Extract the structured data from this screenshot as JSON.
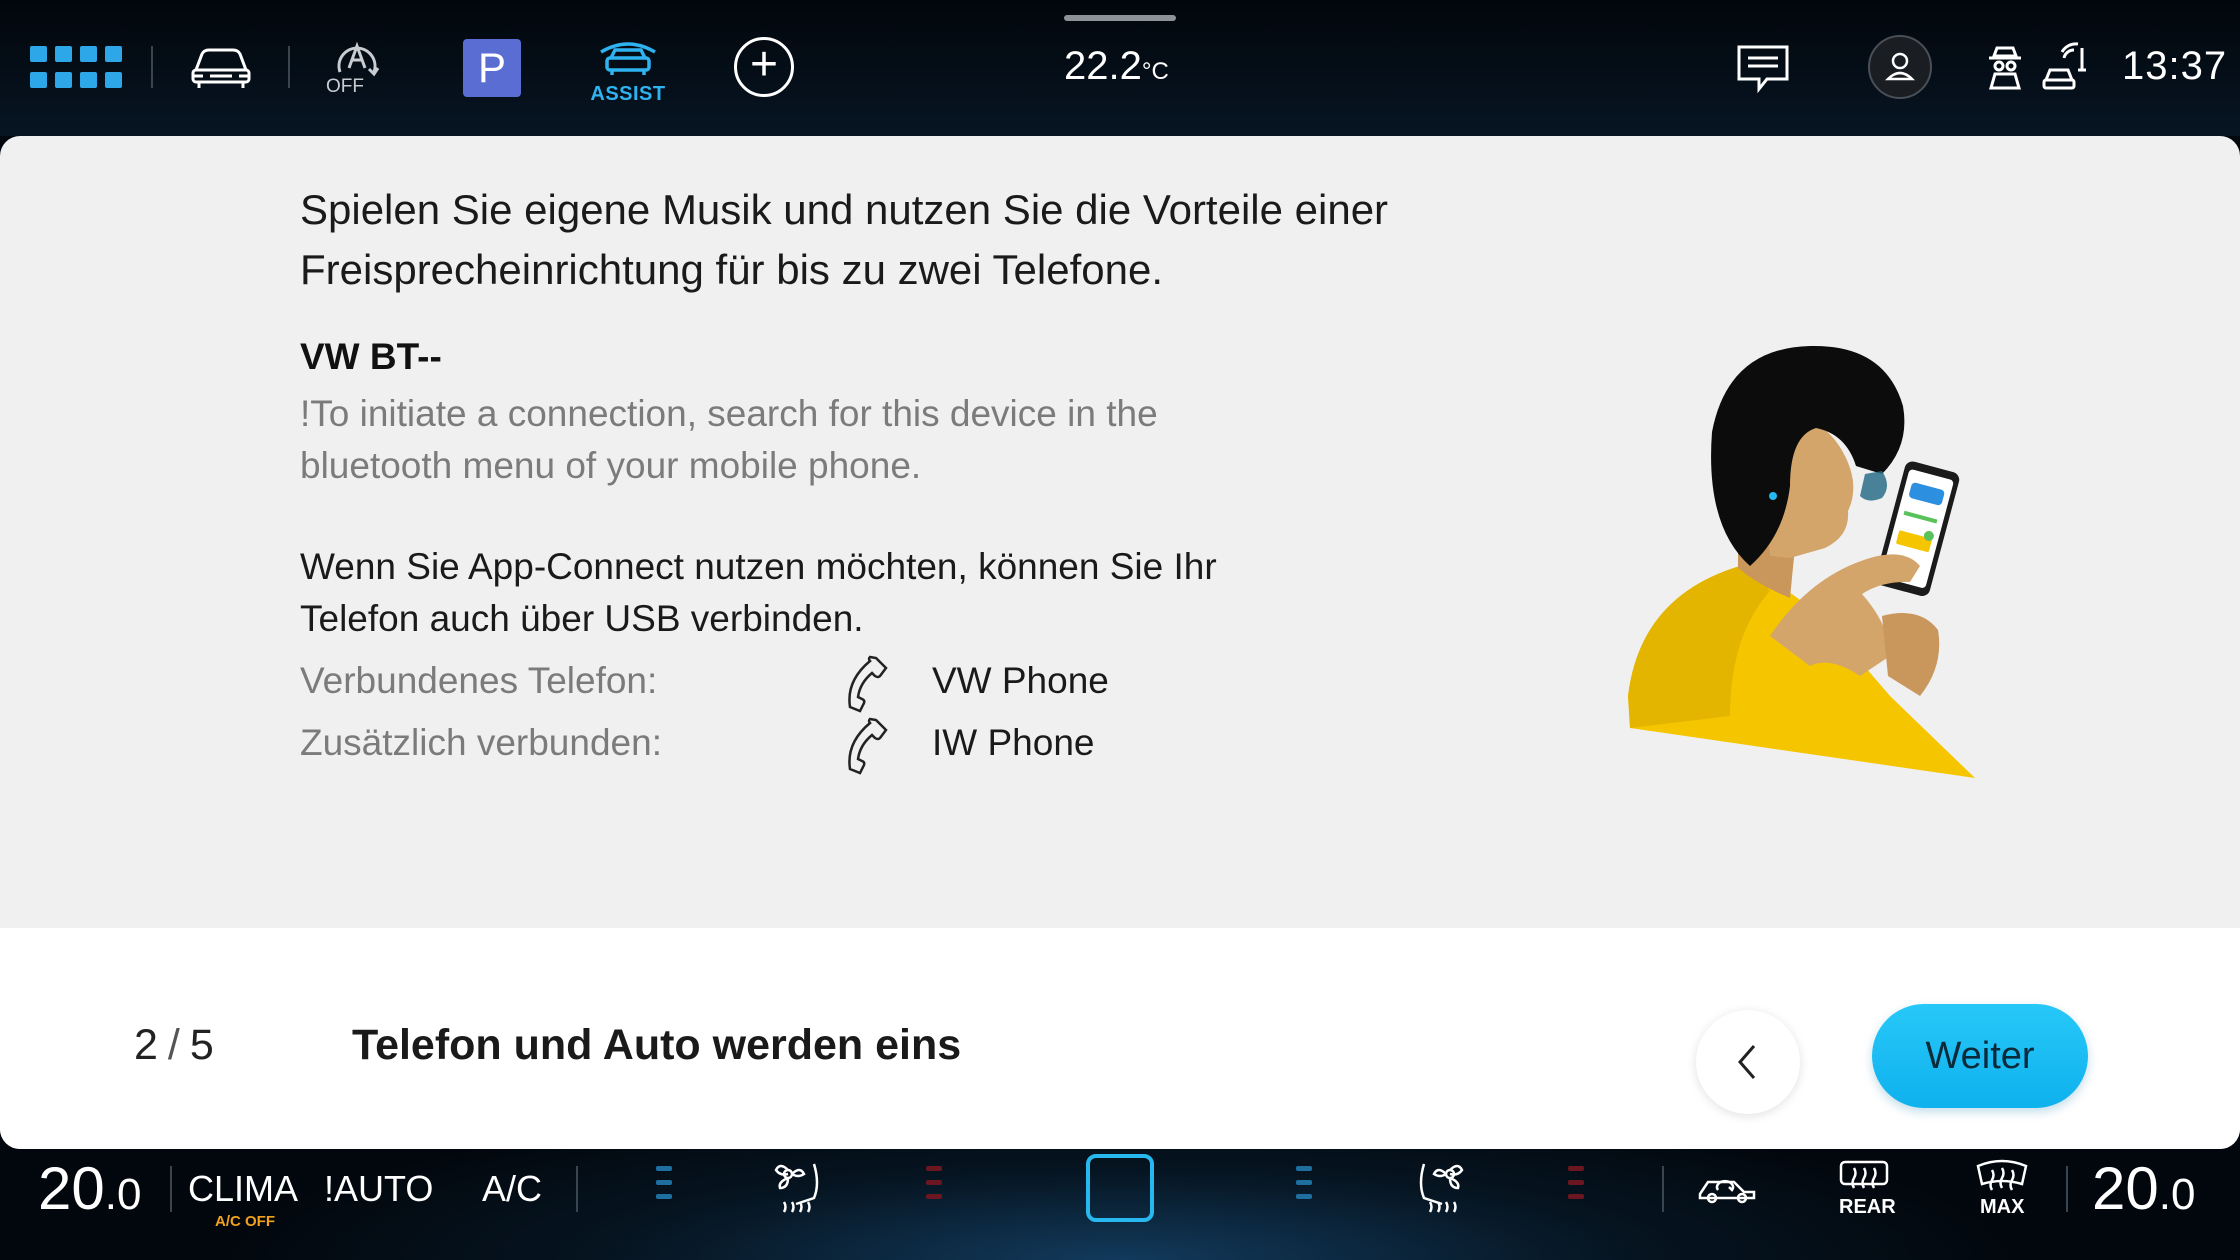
{
  "top_bar": {
    "lane_assist_state": "OFF",
    "parking_label": "P",
    "assist_label": "ASSIST",
    "outside_temperature": "22.2",
    "temperature_unit": "°C",
    "clock": "13:37"
  },
  "content": {
    "headline": "Spielen Sie eigene Musik und nutzen Sie die Vorteile einer Freisprecheinrichtung für bis zu zwei Telefone.",
    "device_name": "VW BT--",
    "connection_hint": "!To initiate a connection, search for this device in the bluetooth menu of your mobile phone.",
    "app_connect_text": "Wenn Sie App-Connect nutzen möchten, können Sie Ihr Telefon auch über USB verbinden.",
    "connected_rows": [
      {
        "label": "Verbundenes Telefon:",
        "value": "VW Phone",
        "icon": "phone-icon"
      },
      {
        "label": "Zusätzlich verbunden:",
        "value": "IW Phone",
        "icon": "phone-icon"
      }
    ]
  },
  "footer": {
    "current_step": "2",
    "separator": "/",
    "total_steps": "5",
    "step_title": "Telefon und Auto werden eins",
    "back_icon": "chevron-left-icon",
    "next_label": "Weiter",
    "progress_fraction": 0.4
  },
  "climate_bar": {
    "left_temperature_int": "20",
    "left_temperature_dec": ".0",
    "clima_label": "CLIMA",
    "ac_off_label": "A/C OFF",
    "auto_label": "!AUTO",
    "ac_label": "A/C",
    "rear_label": "REAR",
    "max_label": "MAX",
    "right_temperature_int": "20",
    "right_temperature_dec": ".0"
  },
  "colors": {
    "accent": "#16a9d8",
    "button": "#1ab9f2",
    "warning": "#f1a21a",
    "card_background": "#f0f0f0"
  }
}
